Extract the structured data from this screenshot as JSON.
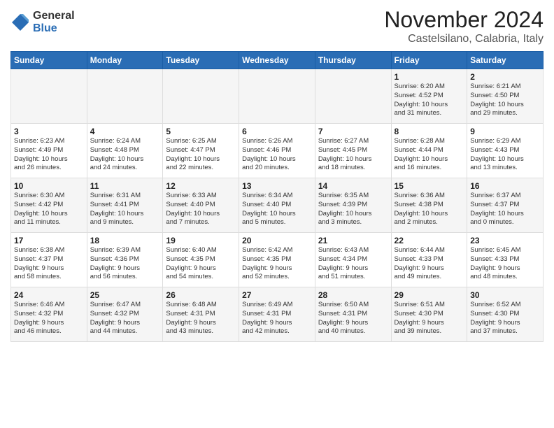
{
  "logo": {
    "general": "General",
    "blue": "Blue"
  },
  "header": {
    "title": "November 2024",
    "subtitle": "Castelsilano, Calabria, Italy"
  },
  "days_of_week": [
    "Sunday",
    "Monday",
    "Tuesday",
    "Wednesday",
    "Thursday",
    "Friday",
    "Saturday"
  ],
  "weeks": [
    [
      {
        "day": "",
        "info": ""
      },
      {
        "day": "",
        "info": ""
      },
      {
        "day": "",
        "info": ""
      },
      {
        "day": "",
        "info": ""
      },
      {
        "day": "",
        "info": ""
      },
      {
        "day": "1",
        "info": "Sunrise: 6:20 AM\nSunset: 4:52 PM\nDaylight: 10 hours\nand 31 minutes."
      },
      {
        "day": "2",
        "info": "Sunrise: 6:21 AM\nSunset: 4:50 PM\nDaylight: 10 hours\nand 29 minutes."
      }
    ],
    [
      {
        "day": "3",
        "info": "Sunrise: 6:23 AM\nSunset: 4:49 PM\nDaylight: 10 hours\nand 26 minutes."
      },
      {
        "day": "4",
        "info": "Sunrise: 6:24 AM\nSunset: 4:48 PM\nDaylight: 10 hours\nand 24 minutes."
      },
      {
        "day": "5",
        "info": "Sunrise: 6:25 AM\nSunset: 4:47 PM\nDaylight: 10 hours\nand 22 minutes."
      },
      {
        "day": "6",
        "info": "Sunrise: 6:26 AM\nSunset: 4:46 PM\nDaylight: 10 hours\nand 20 minutes."
      },
      {
        "day": "7",
        "info": "Sunrise: 6:27 AM\nSunset: 4:45 PM\nDaylight: 10 hours\nand 18 minutes."
      },
      {
        "day": "8",
        "info": "Sunrise: 6:28 AM\nSunset: 4:44 PM\nDaylight: 10 hours\nand 16 minutes."
      },
      {
        "day": "9",
        "info": "Sunrise: 6:29 AM\nSunset: 4:43 PM\nDaylight: 10 hours\nand 13 minutes."
      }
    ],
    [
      {
        "day": "10",
        "info": "Sunrise: 6:30 AM\nSunset: 4:42 PM\nDaylight: 10 hours\nand 11 minutes."
      },
      {
        "day": "11",
        "info": "Sunrise: 6:31 AM\nSunset: 4:41 PM\nDaylight: 10 hours\nand 9 minutes."
      },
      {
        "day": "12",
        "info": "Sunrise: 6:33 AM\nSunset: 4:40 PM\nDaylight: 10 hours\nand 7 minutes."
      },
      {
        "day": "13",
        "info": "Sunrise: 6:34 AM\nSunset: 4:40 PM\nDaylight: 10 hours\nand 5 minutes."
      },
      {
        "day": "14",
        "info": "Sunrise: 6:35 AM\nSunset: 4:39 PM\nDaylight: 10 hours\nand 3 minutes."
      },
      {
        "day": "15",
        "info": "Sunrise: 6:36 AM\nSunset: 4:38 PM\nDaylight: 10 hours\nand 2 minutes."
      },
      {
        "day": "16",
        "info": "Sunrise: 6:37 AM\nSunset: 4:37 PM\nDaylight: 10 hours\nand 0 minutes."
      }
    ],
    [
      {
        "day": "17",
        "info": "Sunrise: 6:38 AM\nSunset: 4:37 PM\nDaylight: 9 hours\nand 58 minutes."
      },
      {
        "day": "18",
        "info": "Sunrise: 6:39 AM\nSunset: 4:36 PM\nDaylight: 9 hours\nand 56 minutes."
      },
      {
        "day": "19",
        "info": "Sunrise: 6:40 AM\nSunset: 4:35 PM\nDaylight: 9 hours\nand 54 minutes."
      },
      {
        "day": "20",
        "info": "Sunrise: 6:42 AM\nSunset: 4:35 PM\nDaylight: 9 hours\nand 52 minutes."
      },
      {
        "day": "21",
        "info": "Sunrise: 6:43 AM\nSunset: 4:34 PM\nDaylight: 9 hours\nand 51 minutes."
      },
      {
        "day": "22",
        "info": "Sunrise: 6:44 AM\nSunset: 4:33 PM\nDaylight: 9 hours\nand 49 minutes."
      },
      {
        "day": "23",
        "info": "Sunrise: 6:45 AM\nSunset: 4:33 PM\nDaylight: 9 hours\nand 48 minutes."
      }
    ],
    [
      {
        "day": "24",
        "info": "Sunrise: 6:46 AM\nSunset: 4:32 PM\nDaylight: 9 hours\nand 46 minutes."
      },
      {
        "day": "25",
        "info": "Sunrise: 6:47 AM\nSunset: 4:32 PM\nDaylight: 9 hours\nand 44 minutes."
      },
      {
        "day": "26",
        "info": "Sunrise: 6:48 AM\nSunset: 4:31 PM\nDaylight: 9 hours\nand 43 minutes."
      },
      {
        "day": "27",
        "info": "Sunrise: 6:49 AM\nSunset: 4:31 PM\nDaylight: 9 hours\nand 42 minutes."
      },
      {
        "day": "28",
        "info": "Sunrise: 6:50 AM\nSunset: 4:31 PM\nDaylight: 9 hours\nand 40 minutes."
      },
      {
        "day": "29",
        "info": "Sunrise: 6:51 AM\nSunset: 4:30 PM\nDaylight: 9 hours\nand 39 minutes."
      },
      {
        "day": "30",
        "info": "Sunrise: 6:52 AM\nSunset: 4:30 PM\nDaylight: 9 hours\nand 37 minutes."
      }
    ]
  ]
}
